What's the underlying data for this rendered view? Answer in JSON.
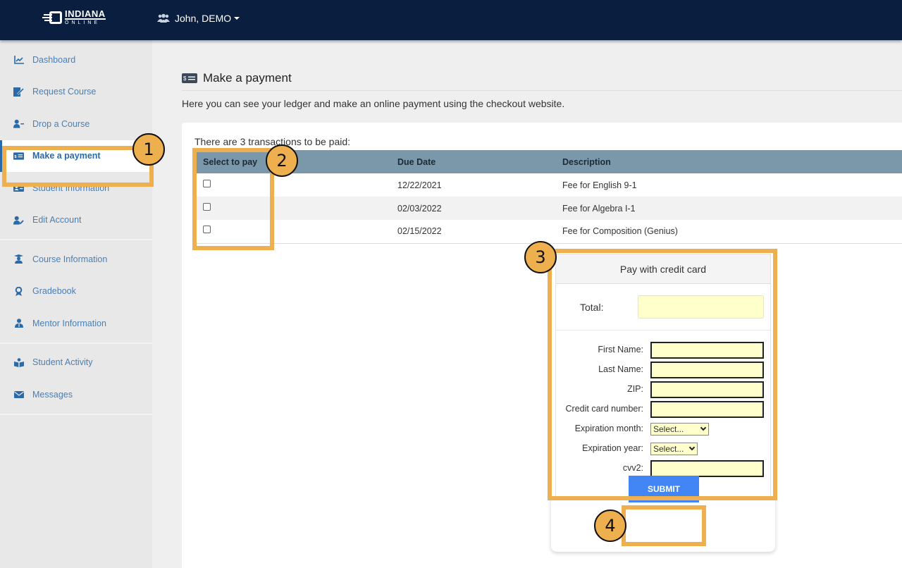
{
  "topbar": {
    "logo": {
      "line1": "INDIANA",
      "line2": "ONLINE"
    },
    "user": {
      "icon": "users-icon",
      "label": "John, DEMO"
    }
  },
  "sidebar": {
    "groups": [
      [
        {
          "label": "Dashboard",
          "icon": "chart-line-icon"
        },
        {
          "label": "Request Course",
          "icon": "file-signature-icon"
        },
        {
          "label": "Drop a Course",
          "icon": "user-minus-icon"
        },
        {
          "label": "Make a payment",
          "icon": "money-check-icon",
          "active": true
        },
        {
          "label": "Student Information",
          "icon": "id-card-icon"
        },
        {
          "label": "Edit Account",
          "icon": "user-edit-icon"
        }
      ],
      [
        {
          "label": "Course Information",
          "icon": "graduate-icon"
        },
        {
          "label": "Gradebook",
          "icon": "award-icon"
        },
        {
          "label": "Mentor Information",
          "icon": "user-tie-icon"
        }
      ],
      [
        {
          "label": "Student Activity",
          "icon": "book-reader-icon"
        },
        {
          "label": "Messages",
          "icon": "envelope-icon"
        }
      ]
    ]
  },
  "main": {
    "title": "Make a payment",
    "title_icon": "money-check-icon",
    "intro": "Here you can see your ledger and make an online payment using the checkout website.",
    "tx_count_text": "There are 3 transactions to be paid:",
    "table": {
      "headers": [
        "Select to pay",
        "Due Date",
        "Description"
      ],
      "rows": [
        {
          "checked": false,
          "due": "12/22/2021",
          "desc": "Fee for English 9-1"
        },
        {
          "checked": false,
          "due": "02/03/2022",
          "desc": "Fee for Algebra I-1"
        },
        {
          "checked": false,
          "due": "02/15/2022",
          "desc": "Fee for Composition (Genius)"
        }
      ]
    },
    "payment": {
      "heading": "Pay with credit card",
      "total_label": "Total:",
      "total_value": "",
      "fields": {
        "first_name": {
          "label": "First Name:",
          "value": ""
        },
        "last_name": {
          "label": "Last Name:",
          "value": ""
        },
        "zip": {
          "label": "ZIP:",
          "value": ""
        },
        "card_number": {
          "label": "Credit card number:",
          "value": ""
        },
        "exp_month": {
          "label": "Expiration month:",
          "selected": "Select..."
        },
        "exp_year": {
          "label": "Expiration year:",
          "selected": "Select..."
        },
        "cvv2": {
          "label": "cvv2:",
          "value": ""
        }
      },
      "submit_label": "SUBMIT"
    }
  },
  "annotations": {
    "color": "#eeaf4f",
    "steps": [
      "1",
      "2",
      "3",
      "4"
    ]
  }
}
